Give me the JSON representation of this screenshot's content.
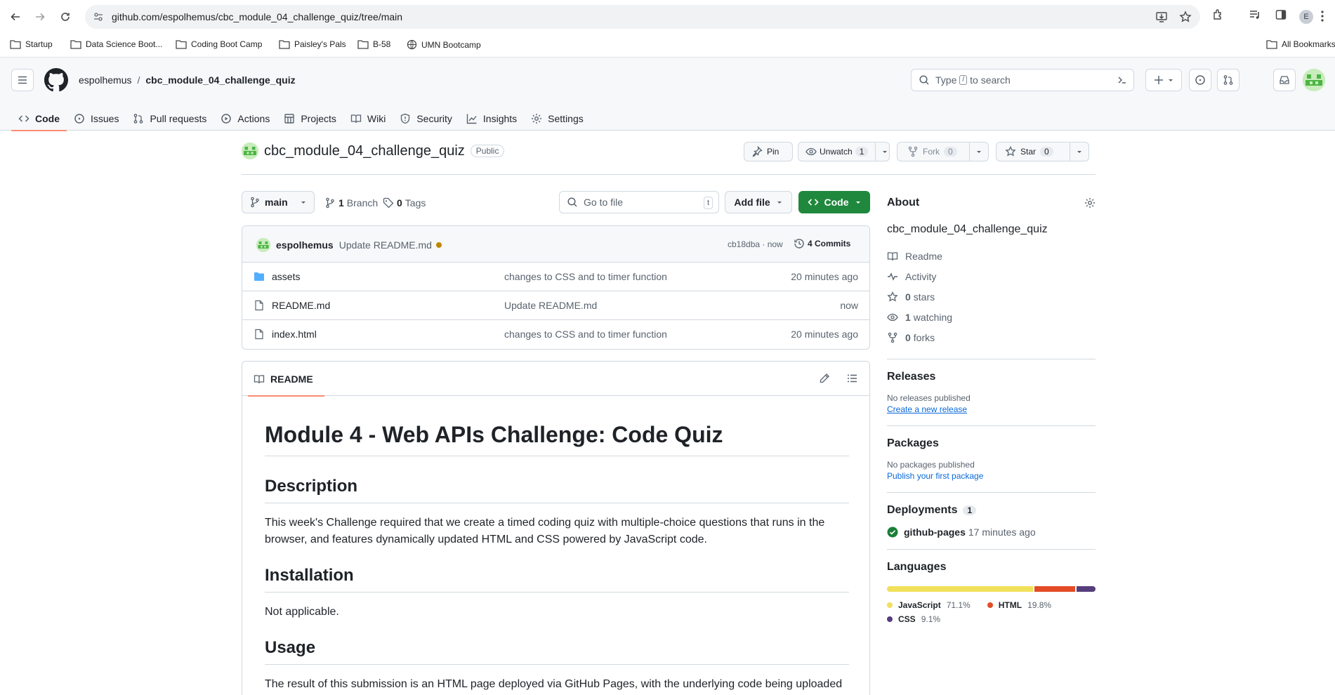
{
  "browser": {
    "url": "github.com/espolhemus/cbc_module_04_challenge_quiz/tree/main",
    "profile_initial": "E",
    "bookmarks": [
      {
        "label": "Startup",
        "icon": "folder-icon"
      },
      {
        "label": "Data Science Boot...",
        "icon": "folder-icon"
      },
      {
        "label": "Coding Boot Camp",
        "icon": "folder-icon"
      },
      {
        "label": "Paisley's Pals",
        "icon": "folder-icon"
      },
      {
        "label": "B-58",
        "icon": "folder-icon"
      },
      {
        "label": "UMN Bootcamp",
        "icon": "globe-icon"
      }
    ],
    "all_bookmarks": "All Bookmarks"
  },
  "header": {
    "owner": "espolhemus",
    "separator": "/",
    "repo": "cbc_module_04_challenge_quiz",
    "search_prefix": "Type",
    "search_key": "/",
    "search_suffix": "to search"
  },
  "tabs": [
    {
      "label": "Code",
      "icon": "code-icon",
      "active": true
    },
    {
      "label": "Issues",
      "icon": "issue-icon"
    },
    {
      "label": "Pull requests",
      "icon": "pull-request-icon"
    },
    {
      "label": "Actions",
      "icon": "play-icon"
    },
    {
      "label": "Projects",
      "icon": "table-icon"
    },
    {
      "label": "Wiki",
      "icon": "book-icon"
    },
    {
      "label": "Security",
      "icon": "shield-icon"
    },
    {
      "label": "Insights",
      "icon": "graph-icon"
    },
    {
      "label": "Settings",
      "icon": "gear-icon"
    }
  ],
  "repo": {
    "name": "cbc_module_04_challenge_quiz",
    "visibility": "Public",
    "pin": "Pin",
    "unwatch": "Unwatch",
    "watch_count": "1",
    "fork": "Fork",
    "fork_count": "0",
    "star": "Star",
    "star_count": "0"
  },
  "toolbar": {
    "branch": "main",
    "branches_count": "1",
    "branches_label": "Branch",
    "tags_count": "0",
    "tags_label": "Tags",
    "goto_placeholder": "Go to file",
    "goto_key": "t",
    "add_file": "Add file",
    "code": "Code"
  },
  "commit": {
    "author": "espolhemus",
    "message": "Update README.md",
    "sha_time": "cb18dba · now",
    "commits": "4 Commits"
  },
  "files": [
    {
      "name": "assets",
      "type": "dir",
      "message": "changes to CSS and to timer function",
      "age": "20 minutes ago"
    },
    {
      "name": "README.md",
      "type": "file",
      "message": "Update README.md",
      "age": "now"
    },
    {
      "name": "index.html",
      "type": "file",
      "message": "changes to CSS and to timer function",
      "age": "20 minutes ago"
    }
  ],
  "readme": {
    "tab": "README",
    "h1": "Module 4 - Web APIs Challenge: Code Quiz",
    "h2_description": "Description",
    "p_description": "This week's Challenge required that we create a timed coding quiz with multiple-choice questions that runs in the browser, and features dynamically updated HTML and CSS powered by JavaScript code.",
    "h2_installation": "Installation",
    "p_installation": "Not applicable.",
    "h2_usage": "Usage",
    "p_usage": "The result of this submission is an HTML page deployed via GitHub Pages, with the underlying code being uploaded within this repository."
  },
  "about": {
    "title": "About",
    "description": "cbc_module_04_challenge_quiz",
    "readme": "Readme",
    "activity": "Activity",
    "stars_count": "0",
    "stars_label": "stars",
    "watching_count": "1",
    "watching_label": "watching",
    "forks_count": "0",
    "forks_label": "forks"
  },
  "releases": {
    "title": "Releases",
    "none": "No releases published",
    "create": "Create a new release"
  },
  "packages": {
    "title": "Packages",
    "none": "No packages published",
    "publish": "Publish your first package"
  },
  "deployments": {
    "title": "Deployments",
    "count": "1",
    "env": "github-pages",
    "time": "17 minutes ago"
  },
  "languages": {
    "title": "Languages",
    "items": [
      {
        "name": "JavaScript",
        "percent": 71.1,
        "label": "71.1%",
        "color": "#f1e05a"
      },
      {
        "name": "HTML",
        "percent": 19.8,
        "label": "19.8%",
        "color": "#e34c26"
      },
      {
        "name": "CSS",
        "percent": 9.1,
        "label": "9.1%",
        "color": "#563d7c"
      }
    ]
  }
}
